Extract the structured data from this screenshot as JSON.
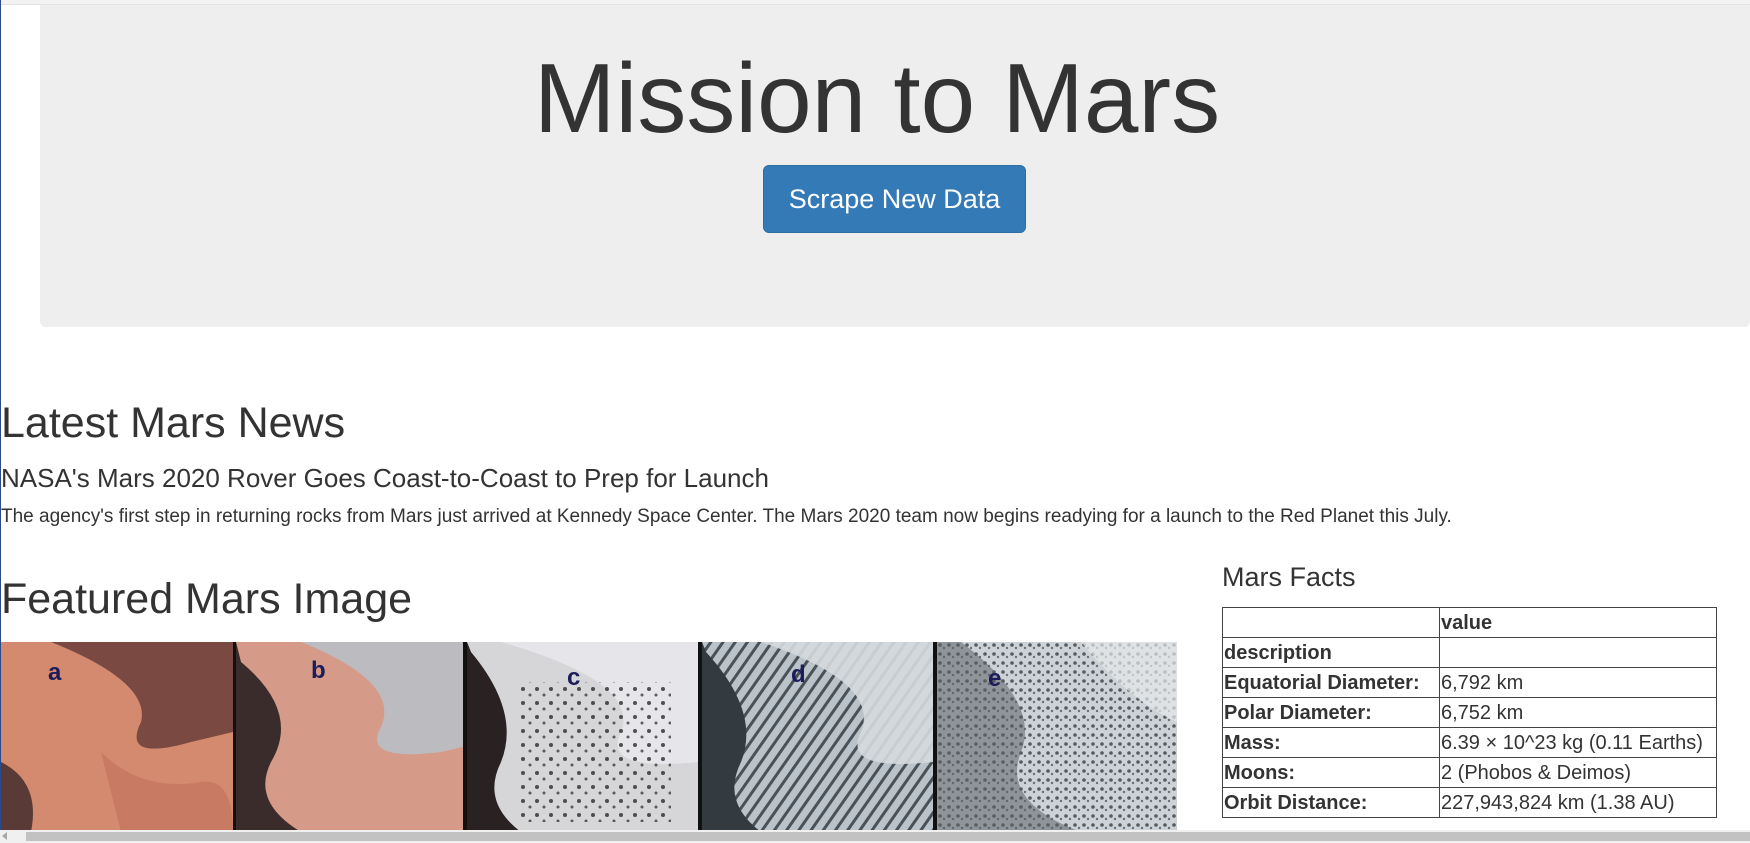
{
  "jumbotron": {
    "title": "Mission to Mars",
    "scrape_button_label": "Scrape New Data",
    "button_color": "#337ab7"
  },
  "news": {
    "section_heading": "Latest Mars News",
    "title": "NASA's Mars 2020 Rover Goes Coast-to-Coast to Prep for Launch",
    "paragraph": "The agency's first step in returning rocks from Mars just arrived at Kennedy Space Center. The Mars 2020 team now begins readying for a launch to the Red Planet this July."
  },
  "featured_image": {
    "section_heading": "Featured Mars Image",
    "panel_labels": [
      "a",
      "b",
      "c",
      "d",
      "e"
    ]
  },
  "facts": {
    "heading": "Mars Facts",
    "header_value": "value",
    "index_label": "description",
    "rows": [
      {
        "label": "Equatorial Diameter:",
        "value": "6,792 km"
      },
      {
        "label": "Polar Diameter:",
        "value": "6,752 km"
      },
      {
        "label": "Mass:",
        "value": "6.39 × 10^23 kg (0.11 Earths)"
      },
      {
        "label": "Moons:",
        "value": "2 (Phobos & Deimos)"
      },
      {
        "label": "Orbit Distance:",
        "value": "227,943,824 km (1.38 AU)"
      }
    ]
  }
}
